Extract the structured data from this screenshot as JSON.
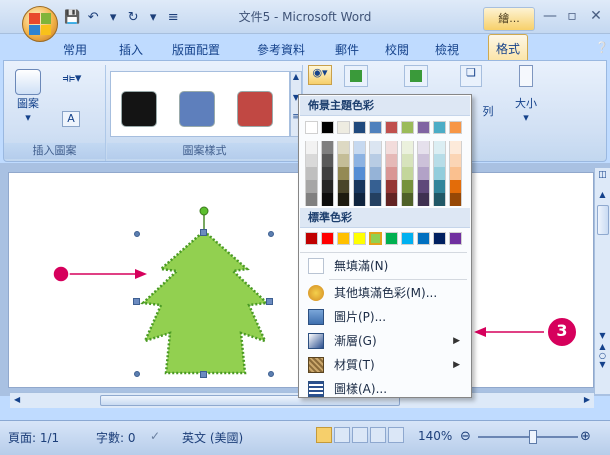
{
  "window": {
    "title": "文件5 - Microsoft Word",
    "context_tab": "繪..."
  },
  "quick_access": {
    "save_icon": "save-icon",
    "undo_icon": "undo-icon",
    "redo_icon": "redo-icon",
    "more_icon": "dropdown-icon"
  },
  "tabs": [
    {
      "label": "常用"
    },
    {
      "label": "插入"
    },
    {
      "label": "版面配置"
    },
    {
      "label": "參考資料"
    },
    {
      "label": "郵件"
    },
    {
      "label": "校閱"
    },
    {
      "label": "檢視"
    },
    {
      "label": "格式"
    }
  ],
  "ribbon": {
    "insert_shape_label": "圖案",
    "insert_group_label": "插入圖案",
    "styles_group_label": "圖案樣式",
    "size_label": "大小",
    "partial_label": "列",
    "swatch_colors": [
      "#141414",
      "#5e7fbc",
      "#c14843"
    ]
  },
  "fill_menu": {
    "theme_heading": "佈景主題色彩",
    "standard_heading": "標準色彩",
    "theme_top_row": [
      "#ffffff",
      "#000000",
      "#eeece1",
      "#1f497d",
      "#4f81bd",
      "#c0504d",
      "#9bbb59",
      "#8064a2",
      "#4bacc6",
      "#f79646"
    ],
    "theme_columns": [
      [
        "#f2f2f2",
        "#d9d9d9",
        "#bfbfbf",
        "#a6a6a6",
        "#808080"
      ],
      [
        "#7f7f7f",
        "#595959",
        "#3f3f3f",
        "#262626",
        "#0d0d0d"
      ],
      [
        "#ddd9c3",
        "#c4bd97",
        "#948a54",
        "#4a452a",
        "#1d1b10"
      ],
      [
        "#c6d9f0",
        "#8db3e2",
        "#548dd4",
        "#17365d",
        "#0f243e"
      ],
      [
        "#dbe5f1",
        "#b8cce4",
        "#95b3d7",
        "#366092",
        "#244061"
      ],
      [
        "#f2dcdb",
        "#e5b9b7",
        "#d99694",
        "#953734",
        "#632423"
      ],
      [
        "#ebf1dd",
        "#d7e3bc",
        "#c3d69b",
        "#76923c",
        "#4f6128"
      ],
      [
        "#e5e0ec",
        "#ccc1d9",
        "#b2a2c7",
        "#5f497a",
        "#3f3151"
      ],
      [
        "#dbeef3",
        "#b7dde8",
        "#92cddc",
        "#31859b",
        "#205867"
      ],
      [
        "#fdeada",
        "#fbd5b5",
        "#fac08f",
        "#e36c09",
        "#974806"
      ]
    ],
    "standard_colors": [
      "#c00000",
      "#ff0000",
      "#ffc000",
      "#ffff00",
      "#92d050",
      "#00b050",
      "#00b0f0",
      "#0070c0",
      "#002060",
      "#7030a0"
    ],
    "selected_standard_index": 4,
    "items": [
      {
        "label": "無填滿(N)",
        "icon": "no-fill-icon",
        "submenu": false
      },
      {
        "label": "其他填滿色彩(M)...",
        "icon": "more-colors-icon",
        "submenu": false
      },
      {
        "label": "圖片(P)...",
        "icon": "picture-icon",
        "submenu": false
      },
      {
        "label": "漸層(G)",
        "icon": "gradient-icon",
        "submenu": true
      },
      {
        "label": "材質(T)",
        "icon": "texture-icon",
        "submenu": true
      },
      {
        "label": "圖樣(A)...",
        "icon": "pattern-icon",
        "submenu": false
      }
    ]
  },
  "document": {
    "shape": "tree-shape",
    "shape_fill": "#92d050",
    "callout_number": "3",
    "callout_color": "#d6005c"
  },
  "status": {
    "page": "頁面: 1/1",
    "words": "字數: 0",
    "language": "英文 (美國)",
    "zoom": "140%",
    "zoom_level_fraction": 0.55
  }
}
